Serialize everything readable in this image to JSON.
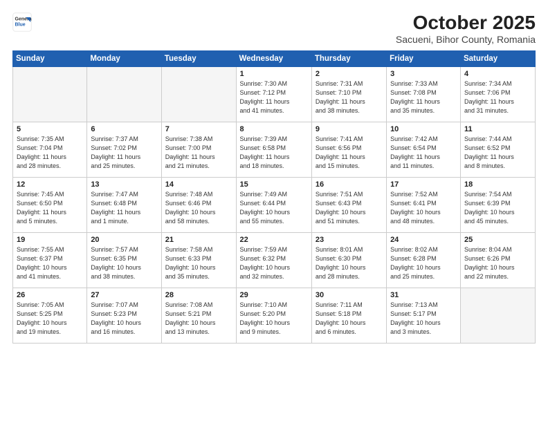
{
  "header": {
    "logo": {
      "general": "General",
      "blue": "Blue"
    },
    "title": "October 2025",
    "subtitle": "Sacueni, Bihor County, Romania"
  },
  "weekdays": [
    "Sunday",
    "Monday",
    "Tuesday",
    "Wednesday",
    "Thursday",
    "Friday",
    "Saturday"
  ],
  "weeks": [
    [
      {
        "day": "",
        "info": ""
      },
      {
        "day": "",
        "info": ""
      },
      {
        "day": "",
        "info": ""
      },
      {
        "day": "1",
        "info": "Sunrise: 7:30 AM\nSunset: 7:12 PM\nDaylight: 11 hours\nand 41 minutes."
      },
      {
        "day": "2",
        "info": "Sunrise: 7:31 AM\nSunset: 7:10 PM\nDaylight: 11 hours\nand 38 minutes."
      },
      {
        "day": "3",
        "info": "Sunrise: 7:33 AM\nSunset: 7:08 PM\nDaylight: 11 hours\nand 35 minutes."
      },
      {
        "day": "4",
        "info": "Sunrise: 7:34 AM\nSunset: 7:06 PM\nDaylight: 11 hours\nand 31 minutes."
      }
    ],
    [
      {
        "day": "5",
        "info": "Sunrise: 7:35 AM\nSunset: 7:04 PM\nDaylight: 11 hours\nand 28 minutes."
      },
      {
        "day": "6",
        "info": "Sunrise: 7:37 AM\nSunset: 7:02 PM\nDaylight: 11 hours\nand 25 minutes."
      },
      {
        "day": "7",
        "info": "Sunrise: 7:38 AM\nSunset: 7:00 PM\nDaylight: 11 hours\nand 21 minutes."
      },
      {
        "day": "8",
        "info": "Sunrise: 7:39 AM\nSunset: 6:58 PM\nDaylight: 11 hours\nand 18 minutes."
      },
      {
        "day": "9",
        "info": "Sunrise: 7:41 AM\nSunset: 6:56 PM\nDaylight: 11 hours\nand 15 minutes."
      },
      {
        "day": "10",
        "info": "Sunrise: 7:42 AM\nSunset: 6:54 PM\nDaylight: 11 hours\nand 11 minutes."
      },
      {
        "day": "11",
        "info": "Sunrise: 7:44 AM\nSunset: 6:52 PM\nDaylight: 11 hours\nand 8 minutes."
      }
    ],
    [
      {
        "day": "12",
        "info": "Sunrise: 7:45 AM\nSunset: 6:50 PM\nDaylight: 11 hours\nand 5 minutes."
      },
      {
        "day": "13",
        "info": "Sunrise: 7:47 AM\nSunset: 6:48 PM\nDaylight: 11 hours\nand 1 minute."
      },
      {
        "day": "14",
        "info": "Sunrise: 7:48 AM\nSunset: 6:46 PM\nDaylight: 10 hours\nand 58 minutes."
      },
      {
        "day": "15",
        "info": "Sunrise: 7:49 AM\nSunset: 6:44 PM\nDaylight: 10 hours\nand 55 minutes."
      },
      {
        "day": "16",
        "info": "Sunrise: 7:51 AM\nSunset: 6:43 PM\nDaylight: 10 hours\nand 51 minutes."
      },
      {
        "day": "17",
        "info": "Sunrise: 7:52 AM\nSunset: 6:41 PM\nDaylight: 10 hours\nand 48 minutes."
      },
      {
        "day": "18",
        "info": "Sunrise: 7:54 AM\nSunset: 6:39 PM\nDaylight: 10 hours\nand 45 minutes."
      }
    ],
    [
      {
        "day": "19",
        "info": "Sunrise: 7:55 AM\nSunset: 6:37 PM\nDaylight: 10 hours\nand 41 minutes."
      },
      {
        "day": "20",
        "info": "Sunrise: 7:57 AM\nSunset: 6:35 PM\nDaylight: 10 hours\nand 38 minutes."
      },
      {
        "day": "21",
        "info": "Sunrise: 7:58 AM\nSunset: 6:33 PM\nDaylight: 10 hours\nand 35 minutes."
      },
      {
        "day": "22",
        "info": "Sunrise: 7:59 AM\nSunset: 6:32 PM\nDaylight: 10 hours\nand 32 minutes."
      },
      {
        "day": "23",
        "info": "Sunrise: 8:01 AM\nSunset: 6:30 PM\nDaylight: 10 hours\nand 28 minutes."
      },
      {
        "day": "24",
        "info": "Sunrise: 8:02 AM\nSunset: 6:28 PM\nDaylight: 10 hours\nand 25 minutes."
      },
      {
        "day": "25",
        "info": "Sunrise: 8:04 AM\nSunset: 6:26 PM\nDaylight: 10 hours\nand 22 minutes."
      }
    ],
    [
      {
        "day": "26",
        "info": "Sunrise: 7:05 AM\nSunset: 5:25 PM\nDaylight: 10 hours\nand 19 minutes."
      },
      {
        "day": "27",
        "info": "Sunrise: 7:07 AM\nSunset: 5:23 PM\nDaylight: 10 hours\nand 16 minutes."
      },
      {
        "day": "28",
        "info": "Sunrise: 7:08 AM\nSunset: 5:21 PM\nDaylight: 10 hours\nand 13 minutes."
      },
      {
        "day": "29",
        "info": "Sunrise: 7:10 AM\nSunset: 5:20 PM\nDaylight: 10 hours\nand 9 minutes."
      },
      {
        "day": "30",
        "info": "Sunrise: 7:11 AM\nSunset: 5:18 PM\nDaylight: 10 hours\nand 6 minutes."
      },
      {
        "day": "31",
        "info": "Sunrise: 7:13 AM\nSunset: 5:17 PM\nDaylight: 10 hours\nand 3 minutes."
      },
      {
        "day": "",
        "info": ""
      }
    ]
  ]
}
